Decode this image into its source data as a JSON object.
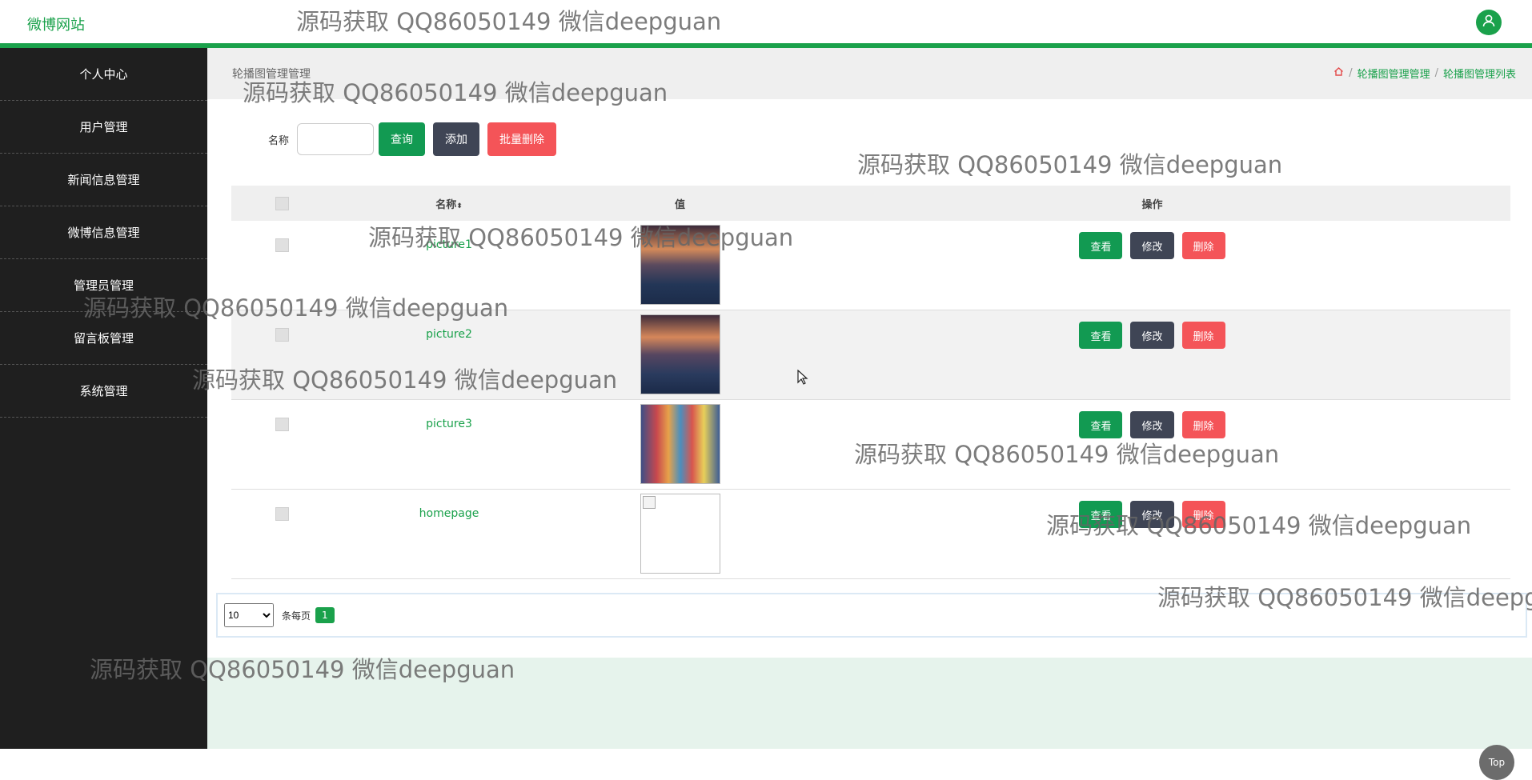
{
  "header": {
    "brand": "微博网站",
    "avatar_icon": "user-icon"
  },
  "sidebar": {
    "items": [
      {
        "label": "个人中心"
      },
      {
        "label": "用户管理"
      },
      {
        "label": "新闻信息管理"
      },
      {
        "label": "微博信息管理"
      },
      {
        "label": "管理员管理"
      },
      {
        "label": "留言板管理"
      },
      {
        "label": "系统管理"
      }
    ]
  },
  "main": {
    "page_title": "轮播图管理管理",
    "breadcrumb": [
      "轮播图管理管理",
      "轮播图管理列表"
    ],
    "breadcrumb_sep": "/",
    "search": {
      "label": "名称",
      "value": "",
      "query_btn": "查询",
      "add_btn": "添加",
      "batch_delete_btn": "批量删除"
    },
    "table": {
      "headers": {
        "name": "名称",
        "value": "值",
        "ops": "操作"
      },
      "rows": [
        {
          "name": "picture1",
          "image": "sunset-lake"
        },
        {
          "name": "picture2",
          "image": "sunset-lake"
        },
        {
          "name": "picture3",
          "image": "colorful-harbor"
        },
        {
          "name": "homepage",
          "image": "broken"
        }
      ],
      "row_actions": {
        "view": "查看",
        "edit": "修改",
        "delete": "删除"
      }
    },
    "pagination": {
      "page_size": "10",
      "per_page_label": "条每页",
      "current_page": "1"
    },
    "top_button": "Top"
  },
  "watermark": "源码获取 QQ86050149 微信deepguan",
  "colors": {
    "brand": "#1aa14b",
    "sidebar": "#1f1f1f",
    "danger": "#f45458",
    "dark": "#3f4555",
    "primary": "#129a52"
  }
}
